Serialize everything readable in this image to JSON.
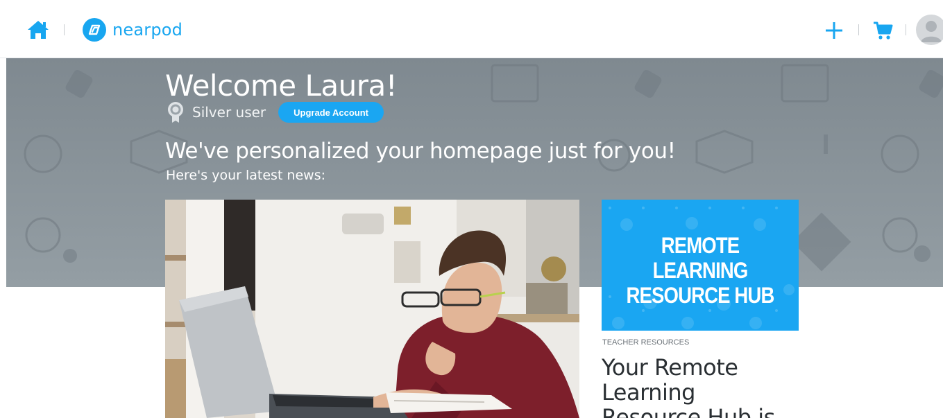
{
  "header": {
    "brand_name": "nearpod",
    "brand_color": "#18a6f0",
    "icons": [
      "home-icon",
      "nearpod-logo-icon",
      "plus-icon",
      "cart-icon",
      "user-avatar-icon"
    ]
  },
  "hero": {
    "welcome": "Welcome Laura!",
    "user_status": "Silver user",
    "status_icon": "silver-medal-icon",
    "upgrade_label": "Upgrade Account",
    "headline": "We've personalized your homepage just for you!",
    "subline": "Here's your latest news:"
  },
  "news": {
    "main_image": "student-with-laptop-image",
    "card": {
      "banner_line1": "REMOTE LEARNING",
      "banner_line2": "RESOURCE HUB",
      "category": "TEACHER RESOURCES",
      "title": "Your Remote Learning Resource Hub is"
    }
  },
  "colors": {
    "accent": "#1aa6f2",
    "hero_bg": "#868f96",
    "text_dark": "#2a2f33"
  }
}
